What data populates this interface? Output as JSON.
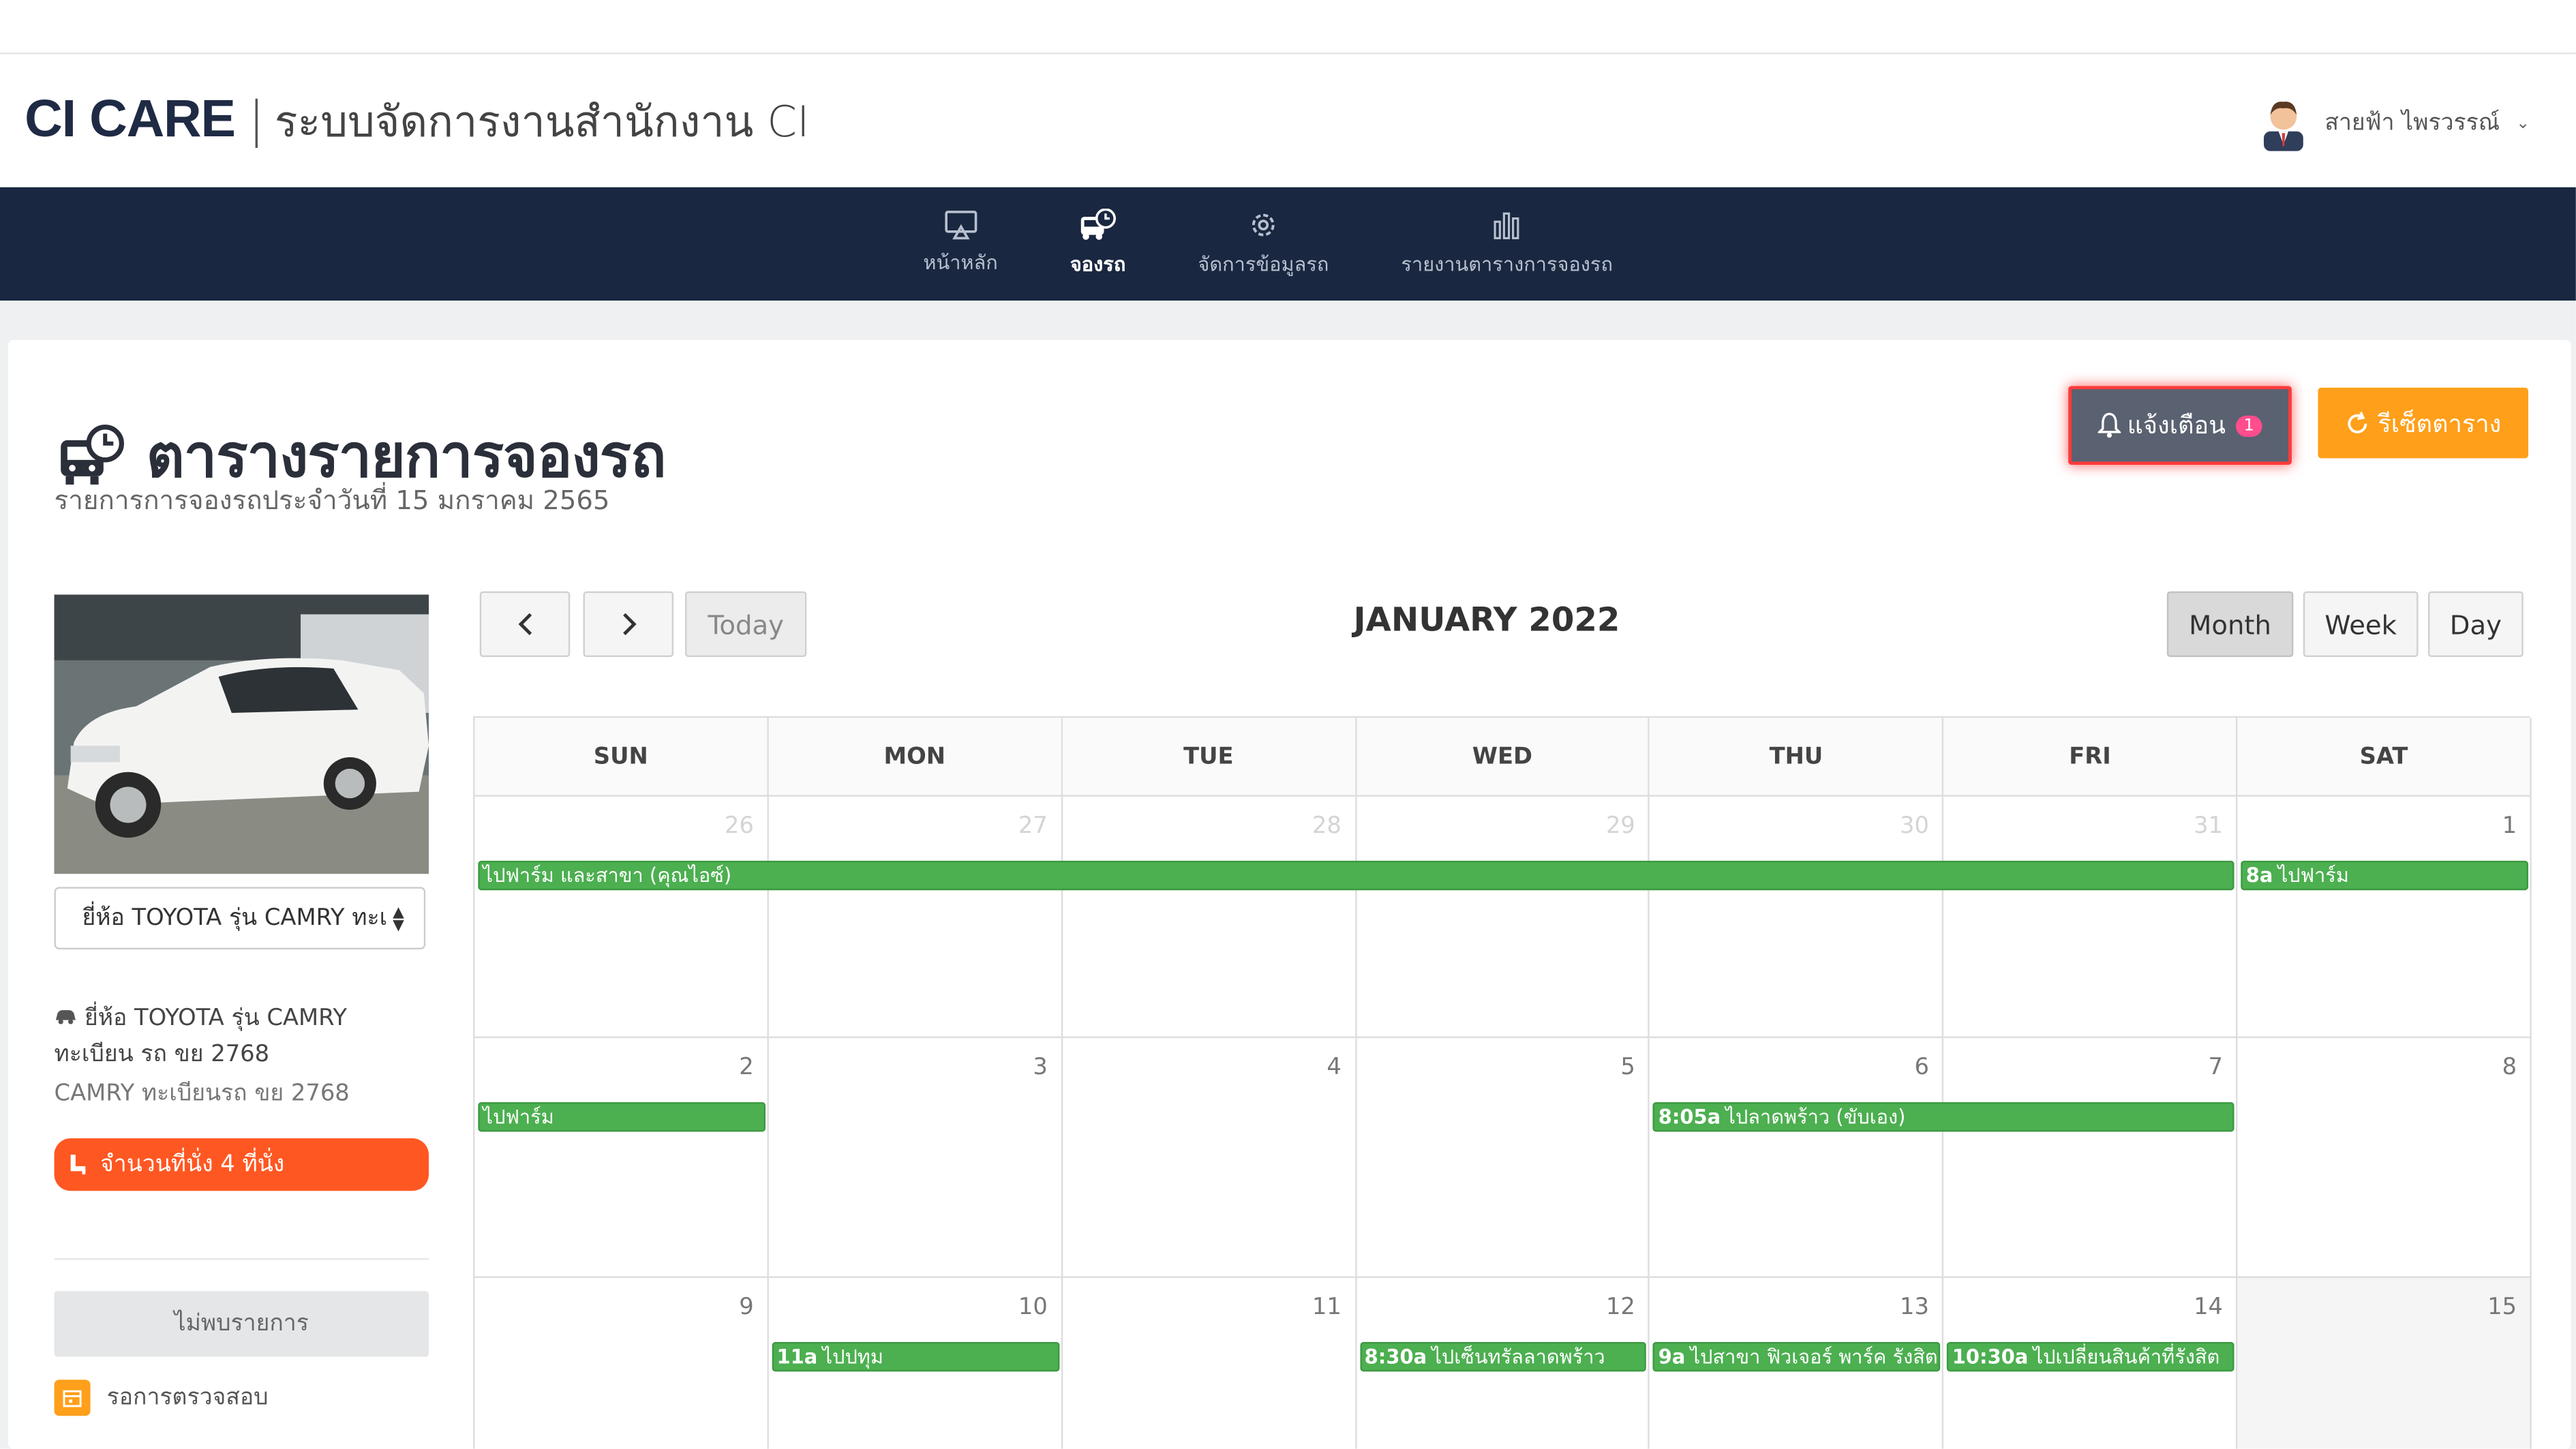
{
  "header": {
    "brand": "CI CARE",
    "separator": "|",
    "subtitle": "ระบบจัดการงานสำนักงาน CI",
    "user_name": "สายฟ้า ไพรวรรณ์",
    "user_chevron": "⌄"
  },
  "nav": {
    "items": [
      {
        "label": "หน้าหลัก",
        "icon": "monitor-icon"
      },
      {
        "label": "จองรถ",
        "icon": "bus-clock-icon",
        "active": true
      },
      {
        "label": "จัดการข้อมูลรถ",
        "icon": "gear-icon"
      },
      {
        "label": "รายงานตารางการจองรถ",
        "icon": "bar-chart-icon"
      }
    ]
  },
  "page": {
    "title": "ตารางรายการจองรถ",
    "subtitle": "รายการการจองรถประจำวันที่ 15 มกราคม 2565",
    "alert_button": "แจ้งเตือน",
    "alert_count": "1",
    "reset_button": "รีเซ็ตตาราง"
  },
  "sidebar": {
    "car_select_value": "ยี่ห้อ TOYOTA รุ่น CAMRY ทะเ",
    "car_info_line": "ยี่ห้อ TOYOTA รุ่น CAMRY ทะเบียน รถ ขย 2768",
    "car_info_sub": "CAMRY ทะเบียนรถ ขย 2768",
    "seat_label": "จำนวนที่นั่ง 4 ที่นั่ง",
    "not_found": "ไม่พบรายการ",
    "legend_label": "รอการตรวจสอบ"
  },
  "calendar": {
    "prev": "‹",
    "next": "›",
    "today": "Today",
    "title": "JANUARY 2022",
    "views": [
      "Month",
      "Week",
      "Day"
    ],
    "active_view": "Month",
    "weekdays": [
      "SUN",
      "MON",
      "TUE",
      "WED",
      "THU",
      "FRI",
      "SAT"
    ],
    "weeks": [
      [
        "26",
        "27",
        "28",
        "29",
        "30",
        "31",
        "1"
      ],
      [
        "2",
        "3",
        "4",
        "5",
        "6",
        "7",
        "8"
      ],
      [
        "9",
        "10",
        "11",
        "12",
        "13",
        "14",
        "15"
      ]
    ],
    "events": [
      {
        "week": 0,
        "start": 0,
        "span": 6,
        "time": "",
        "title": "ไปฟาร์ม และสาขา (คุณไอซ์)"
      },
      {
        "week": 0,
        "start": 6,
        "span": 1,
        "time": "8a",
        "title": "ไปฟาร์ม"
      },
      {
        "week": 1,
        "start": 0,
        "span": 1,
        "time": "",
        "title": "ไปฟาร์ม"
      },
      {
        "week": 1,
        "start": 4,
        "span": 2,
        "time": "8:05a",
        "title": "ไปลาดพร้าว (ขับเอง)"
      },
      {
        "week": 2,
        "start": 1,
        "span": 1,
        "time": "11a",
        "title": "ไปปทุม"
      },
      {
        "week": 2,
        "start": 3,
        "span": 1,
        "time": "8:30a",
        "title": "ไปเซ็นทรัลลาดพร้าว"
      },
      {
        "week": 2,
        "start": 4,
        "span": 1,
        "time": "9a",
        "title": "ไปสาขา ฟิวเจอร์ พาร์ค รังสิต"
      },
      {
        "week": 2,
        "start": 5,
        "span": 1,
        "time": "10:30a",
        "title": "ไปเปลี่ยนสินค้าที่รังสิต"
      }
    ]
  },
  "colors": {
    "nav_bg": "#1a2740",
    "event_green": "#4caf50",
    "reset_orange": "#ff9f1a",
    "seat_orange": "#ff5722",
    "alert_bg": "#5a6170"
  }
}
